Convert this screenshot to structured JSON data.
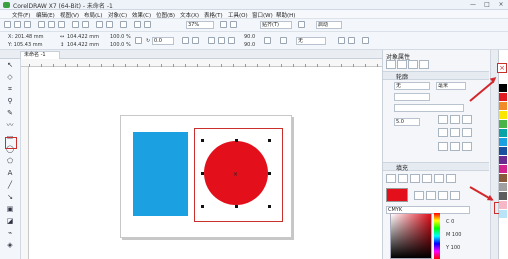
{
  "window": {
    "title": "CorelDRAW X7 (64-Bit) - 未命名 -1",
    "controls": [
      "—",
      "□",
      "×"
    ]
  },
  "menu": [
    "文件(F)",
    "编辑(E)",
    "视图(V)",
    "布局(L)",
    "对象(C)",
    "效果(C)",
    "位图(B)",
    "文本(X)",
    "表格(T)",
    "工具(O)",
    "窗口(W)",
    "帮助(H)"
  ],
  "toolbar": {
    "zoom": "37%",
    "snap_label": "贴齐(T)",
    "launch_label": "启动"
  },
  "propbar": {
    "x": "X: 201.48 mm",
    "y": "Y: 105.43 mm",
    "w": "104.422 mm",
    "h": "104.422 mm",
    "scale_x": "100.0",
    "scale_y": "100.0",
    "pct": "%",
    "angle": "0.0",
    "angle_a": "90.0",
    "angle_b": "90.0",
    "outline": "无"
  },
  "document": {
    "tab": "未命名 -1"
  },
  "docker": {
    "title": "对象属性",
    "outline_header": "轮廓",
    "outline_width": "无",
    "outline_unit": "毫米",
    "corner_value": "5.0",
    "fill_header": "填充",
    "color_model": "CMYK",
    "values": [
      "C 0",
      "M 100",
      "Y 100",
      "K 0"
    ]
  },
  "colors": {
    "blue_shape": "#1ba0e2",
    "red_shape": "#e3101c",
    "annotation": "#c9302c"
  },
  "palette": [
    "#ffffff",
    "#000000",
    "#e21b22",
    "#f28c28",
    "#fbe600",
    "#4bb447",
    "#0aa3a6",
    "#1ba0e2",
    "#1a4fa0",
    "#6c2b90",
    "#d3238e",
    "#8a5a3c",
    "#a0a0a0",
    "#5e5e5e",
    "#f6b7c7",
    "#b9e3f6"
  ]
}
